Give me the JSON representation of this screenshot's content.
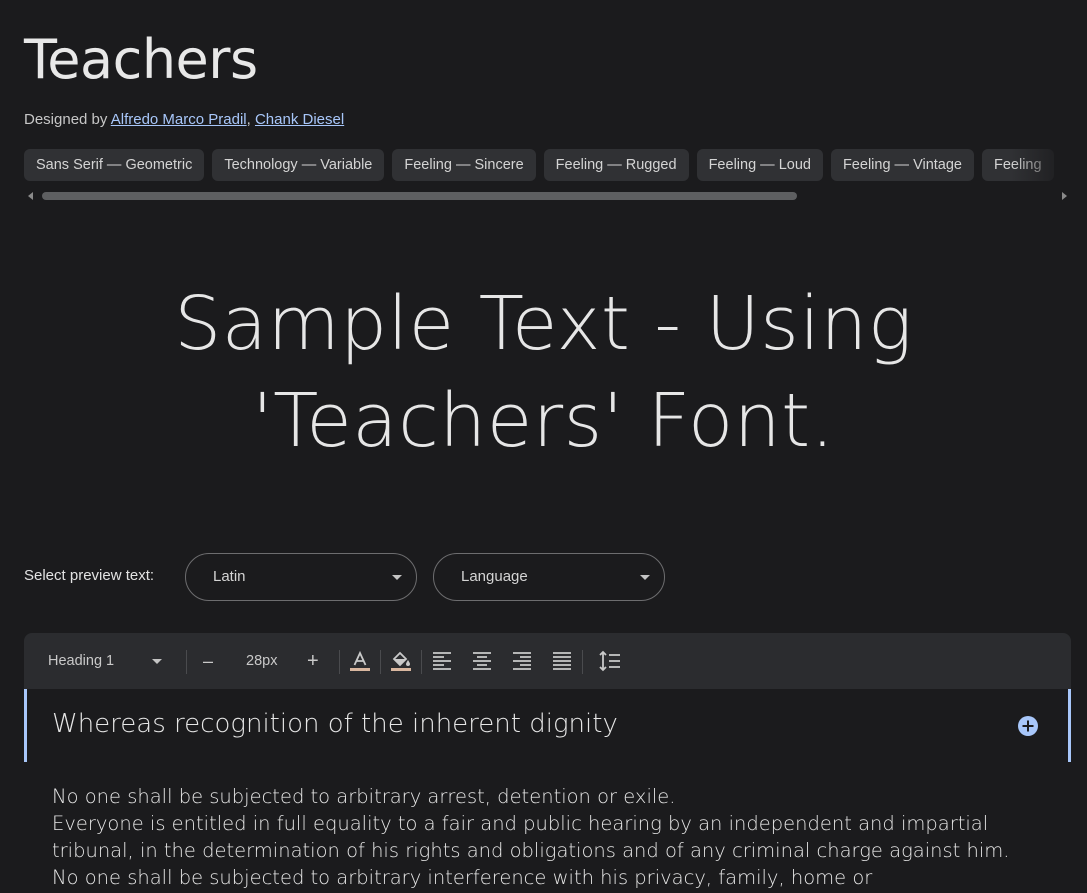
{
  "font": {
    "name": "Teachers",
    "designed_by_label": "Designed by",
    "designers": [
      "Alfredo Marco Pradil",
      "Chank Diesel"
    ],
    "designer_separator": ","
  },
  "tags": [
    "Sans Serif — Geometric",
    "Technology — Variable",
    "Feeling — Sincere",
    "Feeling — Rugged",
    "Feeling — Loud",
    "Feeling — Vintage",
    "Feeling"
  ],
  "sample": {
    "line1": "Sample Text - Using",
    "line2": "'Teachers' Font."
  },
  "preview": {
    "label": "Select preview text:",
    "script_value": "Latin",
    "language_value": "Language"
  },
  "toolbar": {
    "style_value": "Heading 1",
    "decrease_label": "–",
    "size_value": "28px",
    "increase_label": "+"
  },
  "editor": {
    "heading": "Whereas recognition of the inherent dignity",
    "paragraph_lines": [
      "No one shall be subjected to arbitrary arrest, detention or exile.",
      "Everyone is entitled in full equality to a fair and public hearing by an independent and impartial",
      "tribunal, in the determination of his rights and obligations and of any criminal charge against him.",
      "No one shall be subjected to arbitrary interference with his privacy, family, home or"
    ]
  },
  "colors": {
    "background": "#1b1b1d",
    "accent": "#a8c7fa",
    "chip": "#303134",
    "toolbar": "#2b2c2f"
  }
}
